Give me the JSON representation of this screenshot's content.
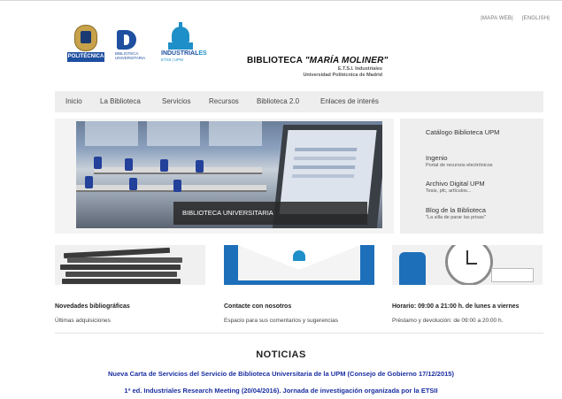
{
  "topbar": {
    "links": [
      "|MAPA WEB|",
      "|ENGLISH|"
    ]
  },
  "logos": {
    "politecnica": "POLITÉCNICA",
    "biblioteca": "BIBLIOTECA UNIVERSITARIA",
    "industriales_main": "INDUSTRIAL",
    "industriales_accent": "ES",
    "industriales_sub": "ETSII | UPM"
  },
  "header": {
    "title_prefix": "BIBLIOTECA ",
    "title_name": "\"MARÍA MOLINER\"",
    "subtitle_line1": "E.T.S.I. Industriales",
    "subtitle_line2": "Universidad Politécnica de Madrid"
  },
  "nav": {
    "items": [
      "Inicio",
      "La Biblioteca",
      "Servicios",
      "Recursos",
      "Biblioteca 2.0",
      "Enlaces de interés"
    ]
  },
  "hero": {
    "caption": "BIBLIOTECA UNIVERSITARIA"
  },
  "sidebar": {
    "items": [
      {
        "label": "Catálogo Biblioteca UPM",
        "desc": ""
      },
      {
        "label": "Ingenio",
        "desc": "Portal de recursos electrónicos"
      },
      {
        "label": "Archivo Digital UPM",
        "desc": "Tesis, pfc, artículos..."
      },
      {
        "label": "Blog de la Biblioteca",
        "desc": "\"La silla de parar las prisas\""
      }
    ]
  },
  "cards": [
    {
      "title": "Novedades bibliográficas",
      "desc": "Últimas adquisiciones",
      "icon": "books-image"
    },
    {
      "title": "Contacte con nosotros",
      "desc": "Espacio para sus comentarios y sugerencias",
      "icon": "envelope-image"
    },
    {
      "title": "Horario: 09:00 a 21:00 h. de lunes a viernes",
      "desc": "Préstamo y devolución: de 09:00 a 20:00 h.",
      "icon": "clock-image"
    }
  ],
  "news": {
    "title": "NOTICIAS",
    "items": [
      "Nueva Carta de Servicios del Servicio de Biblioteca Universitaria de la UPM (Consejo de Gobierno 17/12/2015)",
      "1ª ed. Industriales Research Meeting (20/04/2016). Jornada de investigación organizada por la ETSII"
    ]
  },
  "colors": {
    "brand_blue": "#1e4fa0",
    "accent_blue": "#1e8fc8",
    "news_link": "#1a2fa0",
    "nav_bg": "#eeeeee"
  }
}
